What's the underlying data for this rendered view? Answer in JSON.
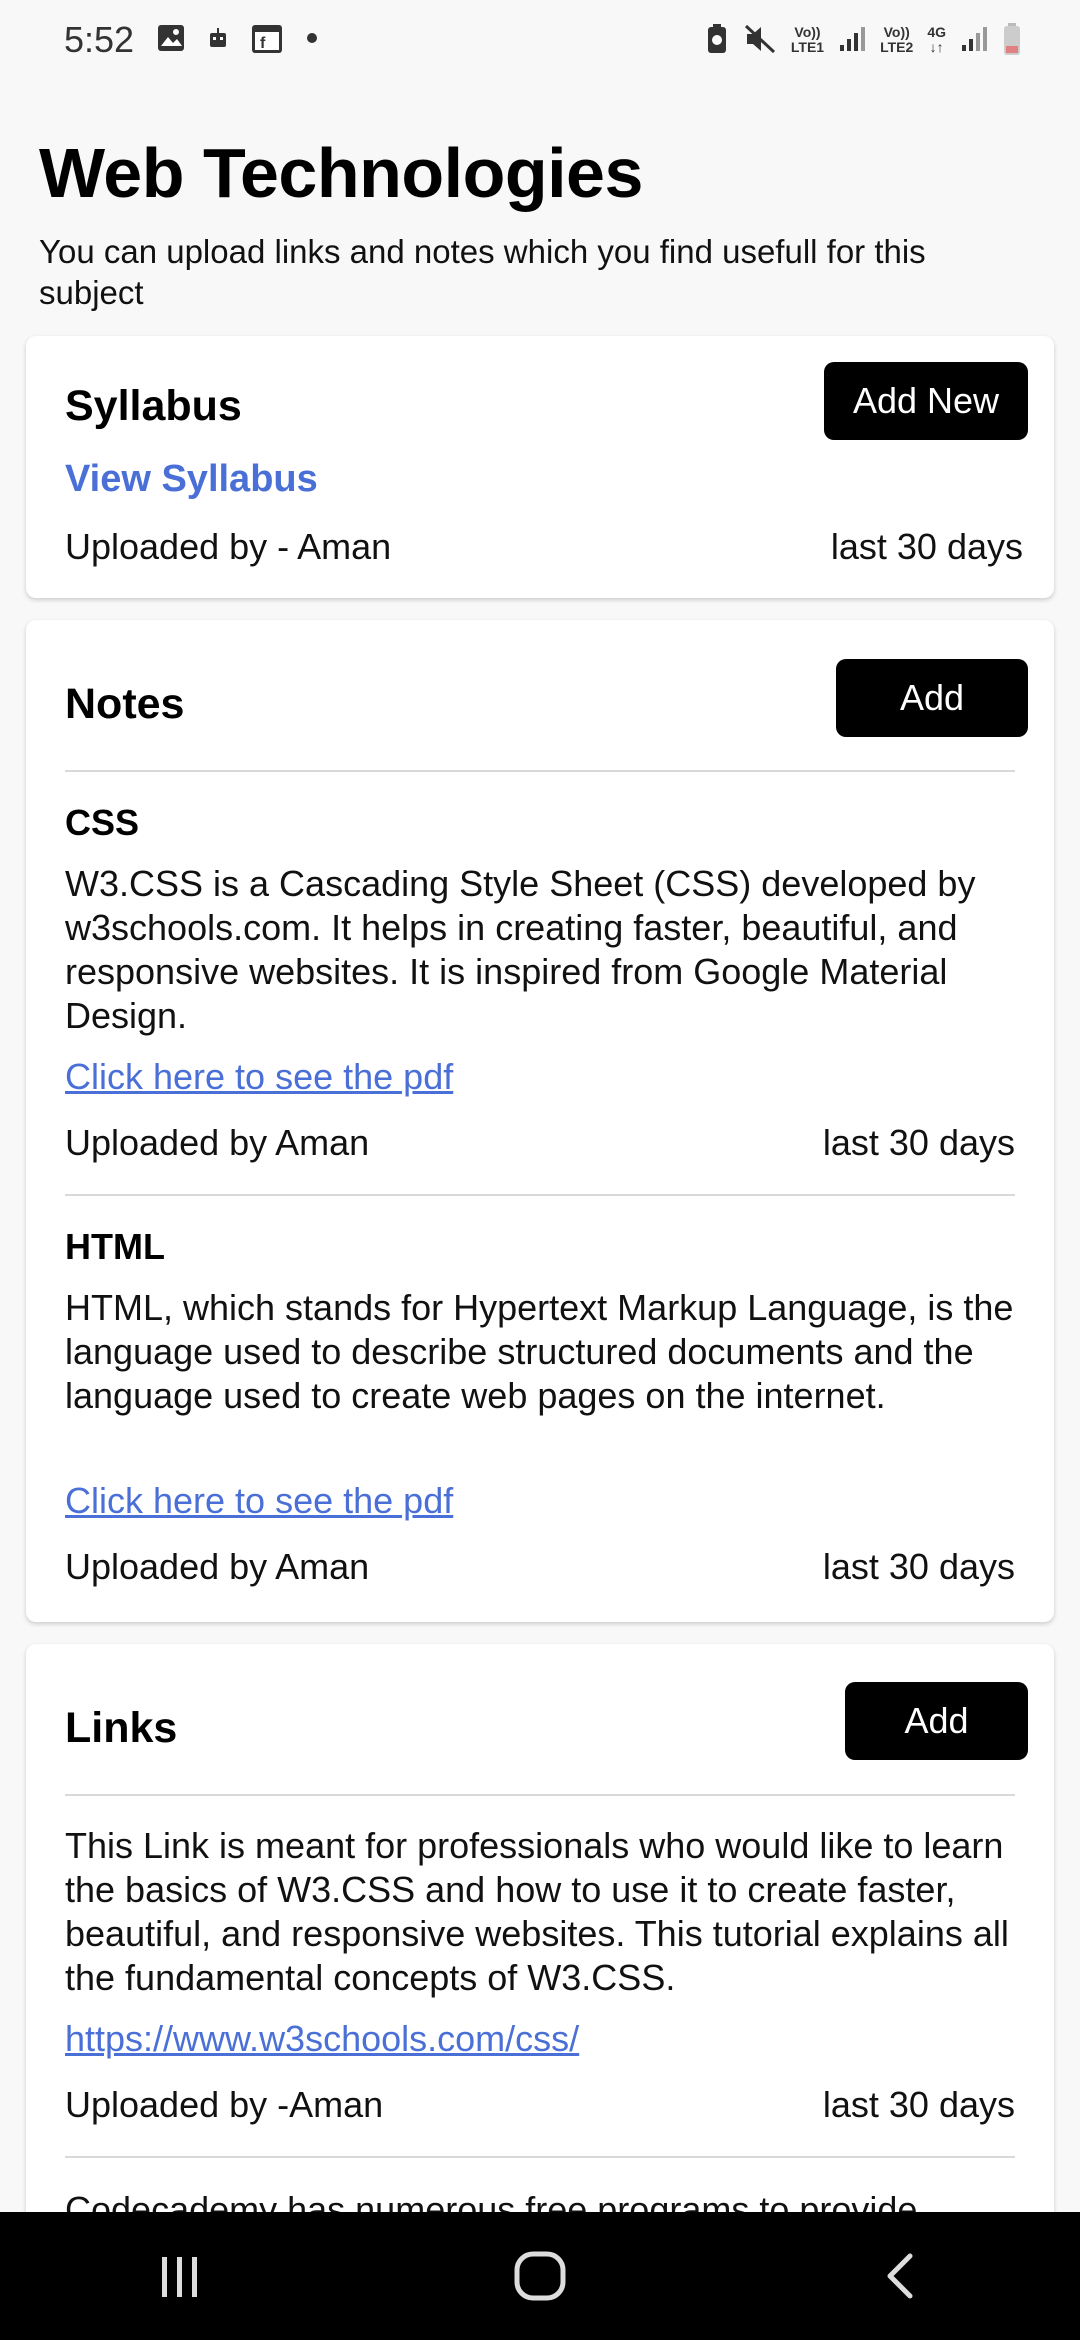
{
  "status_bar": {
    "time": "5:52",
    "sim1_top": "Vo))",
    "sim1_bottom": "LTE1",
    "sim2_top": "Vo))",
    "sim2_bottom": "LTE2",
    "network": "4G"
  },
  "page": {
    "title": "Web Technologies",
    "subtitle": "You can upload links and notes which you find usefull for this subject"
  },
  "syllabus": {
    "title": "Syllabus",
    "add_label": "Add New",
    "view_link": "View Syllabus",
    "uploaded_by": "Uploaded by - Aman",
    "time": "last 30 days"
  },
  "notes": {
    "title": "Notes",
    "add_label": "Add",
    "items": [
      {
        "title": "CSS",
        "description": "W3.CSS is a Cascading Style Sheet (CSS) developed by w3schools.com. It helps in creating faster, beautiful, and responsive websites. It is inspired from Google Material Design.",
        "link": "Click here to see the pdf",
        "uploaded_by": "Uploaded by Aman",
        "time": "last 30 days"
      },
      {
        "title": "HTML",
        "description": "HTML, which stands for Hypertext Markup Language, is the language used to describe structured documents and the language used to create web pages on the internet.",
        "link": "Click here to see the pdf",
        "uploaded_by": "Uploaded by Aman",
        "time": "last 30 days"
      }
    ]
  },
  "links": {
    "title": "Links",
    "add_label": "Add",
    "items": [
      {
        "description": "This Link is meant for professionals who would like to learn the basics of W3.CSS and how to use it to create faster, beautiful, and responsive websites. This tutorial explains all the fundamental concepts of W3.CSS.",
        "url": "https://www.w3schools.com/css/",
        "uploaded_by": "Uploaded by -Aman",
        "time": "last 30 days"
      },
      {
        "description": "Codecademy has numerous free programs to provide"
      }
    ]
  },
  "nav": {
    "recents_icon": "recents-icon",
    "home_icon": "home-icon",
    "back_icon": "back-icon"
  }
}
